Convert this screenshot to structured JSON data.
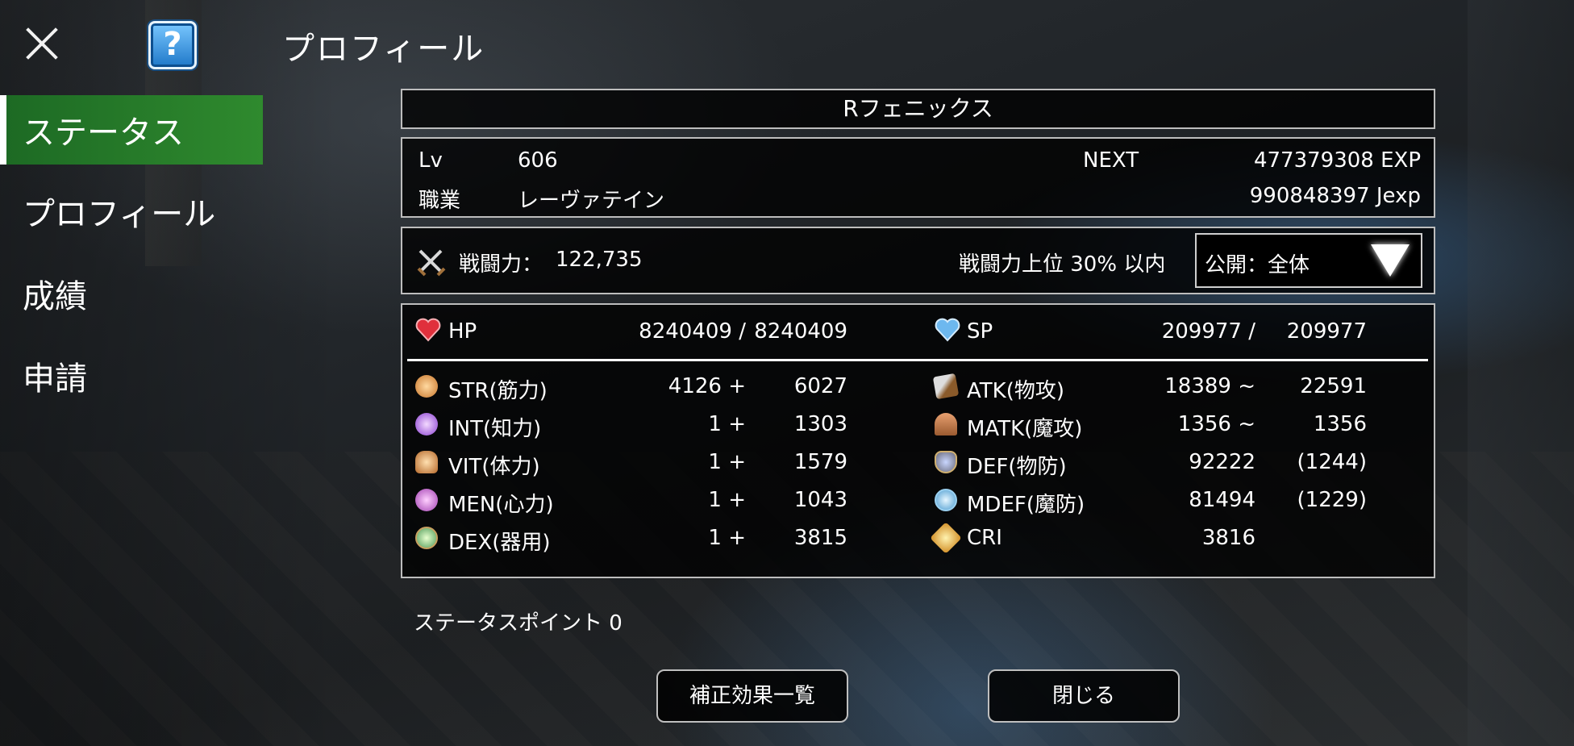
{
  "header": {
    "title": "プロフィール"
  },
  "sidebar": {
    "items": [
      {
        "label": "ステータス"
      },
      {
        "label": "プロフィール"
      },
      {
        "label": "成績"
      },
      {
        "label": "申請"
      }
    ]
  },
  "character": {
    "name": "Rフェニックス"
  },
  "info": {
    "lv_label": "Lv",
    "lv_value": "606",
    "next_label": "NEXT",
    "exp_value": "477379308 EXP",
    "job_label": "職業",
    "job_value": "レーヴァテイン",
    "jexp_value": "990848397 Jexp"
  },
  "combat": {
    "power_label": "戦闘力：",
    "power_value": "122,735",
    "rank_text": "戦闘力上位 30% 以内",
    "visibility": "公開：全体"
  },
  "hp": {
    "label": "HP",
    "current": "8240409 /",
    "max": "8240409"
  },
  "sp": {
    "label": "SP",
    "current": "209977 /",
    "max": "209977"
  },
  "base_stats": [
    {
      "label": "STR(筋力)",
      "base": "4126 +",
      "bonus": "6027",
      "icon": "str-icon"
    },
    {
      "label": "INT(知力)",
      "base": "1 +",
      "bonus": "1303",
      "icon": "int-icon"
    },
    {
      "label": "VIT(体力)",
      "base": "1 +",
      "bonus": "1579",
      "icon": "vit-icon"
    },
    {
      "label": "MEN(心力)",
      "base": "1 +",
      "bonus": "1043",
      "icon": "men-icon"
    },
    {
      "label": "DEX(器用)",
      "base": "1 +",
      "bonus": "3815",
      "icon": "dex-icon"
    }
  ],
  "combat_stats": [
    {
      "label": "ATK(物攻)",
      "v1": "18389 ~",
      "v2": "22591",
      "icon": "atk-icon"
    },
    {
      "label": "MATK(魔攻)",
      "v1": "1356 ~",
      "v2": "1356",
      "icon": "matk-icon"
    },
    {
      "label": "DEF(物防)",
      "v1": "92222",
      "v2": "(1244)",
      "icon": "def-icon"
    },
    {
      "label": "MDEF(魔防)",
      "v1": "81494",
      "v2": "(1229)",
      "icon": "mdef-icon"
    },
    {
      "label": "CRI",
      "v1": "3816",
      "v2": "",
      "icon": "cri-icon"
    }
  ],
  "status_points": "ステータスポイント 0",
  "buttons": {
    "effects": "補正効果一覧",
    "close": "閉じる"
  },
  "colors": {
    "active_tab": "#2f8a2e",
    "panel_border": "#bdbdbd"
  }
}
